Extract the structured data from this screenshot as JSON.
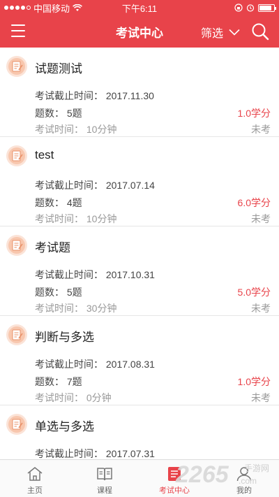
{
  "status_bar": {
    "carrier": "中国移动",
    "time": "下午6:11",
    "signal_dots": 4
  },
  "nav": {
    "title": "考试中心",
    "filter_label": "筛选",
    "menu_icon": "hamburger-menu-icon",
    "search_icon": "search-icon",
    "accent_color": "#e8434a"
  },
  "labels": {
    "deadline_prefix": "考试截止时间：",
    "count_prefix": "题数：",
    "time_prefix": "考试时间："
  },
  "exams": [
    {
      "title": "试题测试",
      "deadline": "考试截止时间：  2017.11.30",
      "count": "题数：  5题",
      "duration": "考试时间：  10分钟",
      "credit": "1.0学分",
      "status": "未考"
    },
    {
      "title": "test",
      "deadline": "考试截止时间：  2017.07.14",
      "count": "题数：  4题",
      "duration": "考试时间：  10分钟",
      "credit": "6.0学分",
      "status": "未考"
    },
    {
      "title": "考试题",
      "deadline": "考试截止时间：  2017.10.31",
      "count": "题数：  5题",
      "duration": "考试时间：  30分钟",
      "credit": "5.0学分",
      "status": "未考"
    },
    {
      "title": "判断与多选",
      "deadline": "考试截止时间：  2017.08.31",
      "count": "题数：  7题",
      "duration": "考试时间：  0分钟",
      "credit": "1.0学分",
      "status": "未考"
    },
    {
      "title": "单选与多选",
      "deadline": "考试截止时间：  2017.07.31",
      "count": "",
      "duration": "",
      "credit": "",
      "status": ""
    }
  ],
  "tabs": [
    {
      "label": "主页",
      "icon": "home-icon",
      "active": false
    },
    {
      "label": "课程",
      "icon": "book-icon",
      "active": false
    },
    {
      "label": "考试中心",
      "icon": "exam-list-icon",
      "active": true
    },
    {
      "label": "我的",
      "icon": "profile-icon",
      "active": false
    }
  ],
  "watermark": {
    "text": "2265",
    "sub": ".com",
    "site": "手游网"
  }
}
